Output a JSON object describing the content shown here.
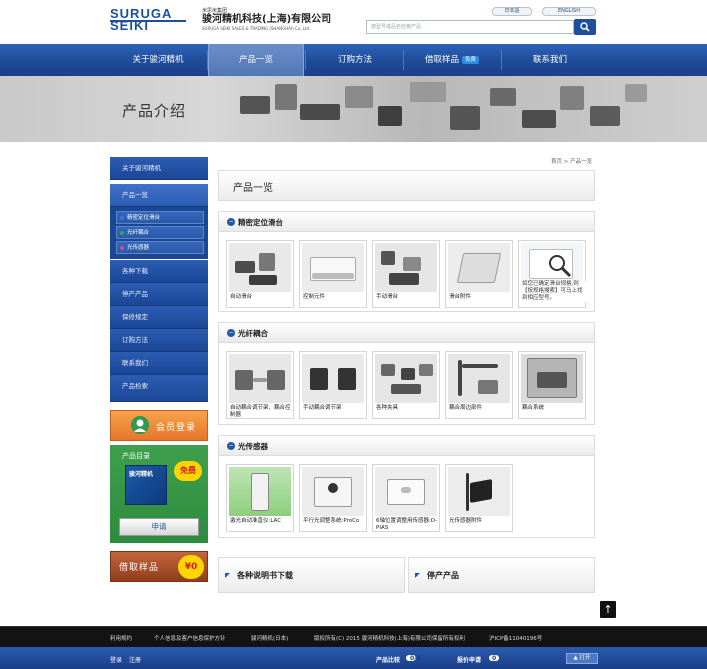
{
  "header": {
    "logo_line1": "SURUGA",
    "logo_line2": "SEIKI",
    "group": "米思米集团",
    "company_cn": "骏河精机科技(上海)有限公司",
    "company_en": "SURUGA SEIKI SALES & TRADING (SHANGHAI) Co.,Ltd.",
    "lang_jp": "日本語",
    "lang_en": "ENGLISH",
    "search_placeholder": "按型号或品名检索产品",
    "search_icon": "search-icon"
  },
  "nav": {
    "items": [
      {
        "label": "关于骏河精机"
      },
      {
        "label": "产品一览"
      },
      {
        "label": "订购方法"
      },
      {
        "label": "借取样品",
        "badge": "免费"
      },
      {
        "label": "联系我们"
      }
    ]
  },
  "banner": {
    "title": "产品介绍"
  },
  "sidebar": {
    "items": [
      "关于骏河精机",
      "产品一览",
      "各种下载",
      "停产产品",
      "保修规定",
      "订购方法",
      "联系我们",
      "产品检索"
    ],
    "subitems": [
      "精密定位滑台",
      "光纤耦合",
      "光传感器"
    ],
    "subitem_dot_colors": [
      "#3a78d6",
      "#2fae4f",
      "#d44b8d"
    ],
    "member_label": "会员登录",
    "catalog_title": "产品目录",
    "catalog_badge": "免费",
    "catalog_book": "骏河精机",
    "catalog_apply": "申请",
    "borrow_label": "借取样品",
    "borrow_badge": "¥0"
  },
  "main": {
    "breadcrumb": {
      "home": "首页",
      "sep": ">",
      "current": "产品一览"
    },
    "page_title": "产品一览",
    "sections": [
      {
        "title": "精密定位滑台",
        "items": [
          "自动滑台",
          "控制元件",
          "手动滑台",
          "滑台附件",
          "如您已确定滑台规格,则【按规格搜索】可马上找到相应型号。"
        ]
      },
      {
        "title": "光纤耦合",
        "items": [
          "自动耦合调节架、耦合控制器",
          "手动耦合调节架",
          "各种夹具",
          "耦合周边部件",
          "耦合系统"
        ]
      },
      {
        "title": "光传感器",
        "items": [
          "激光自动准直仪:LAC",
          "平行光调整系统:ProCo",
          "6轴位置调整用传感器:D-PIAS",
          "光传感器附件"
        ]
      }
    ],
    "download_title": "各种说明书下载",
    "discontinued_title": "停产产品",
    "to_top": "↑"
  },
  "footer": {
    "links": [
      "利用规约",
      "个人信息及客户信息保护方针",
      "骏河精机(日本)"
    ],
    "copyright": "版权所有(C) 2015 骏河精机科技(上海)有限公司保留所有权利",
    "icp": "沪ICP备11040196号",
    "login": "登录",
    "register": "注册",
    "compare_label": "产品比较",
    "compare_count": "0/3",
    "quote_label": "报价申请",
    "quote_count": "0",
    "open_label": "打开"
  }
}
